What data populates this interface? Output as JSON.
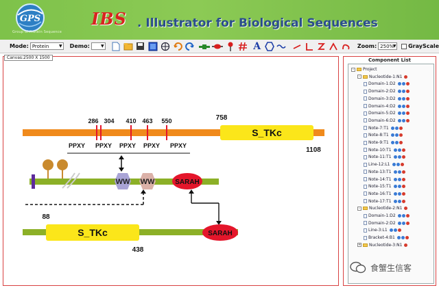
{
  "banner": {
    "logo_text": "GPS",
    "logo_subtext": "Group of Protein Sequence",
    "app_short": "IBS",
    "app_full": "Illustrator for Biological Sequences",
    "colors": {
      "banner": "#7ec24a",
      "ibs": "#d8241f",
      "tagline": "#2a4d8c"
    }
  },
  "toolbar": {
    "mode_label": "Mode:",
    "mode_value": "Protein",
    "demo_label": "Demo:",
    "demo_value": "",
    "zoom_label": "Zoom:",
    "zoom_value": "250%",
    "grayscale_label": "GrayScale",
    "grayscale_checked": false,
    "tools": [
      "new-file-icon",
      "open-file-icon",
      "save-icon",
      "canvas-icon",
      "target-icon",
      "undo-icon",
      "redo-icon",
      "domain-icon",
      "red-domain-icon",
      "pin-icon",
      "hash-icon",
      "text-icon",
      "hexagon-icon",
      "wave-icon",
      "line-icon",
      "elbow-line-icon",
      "bracket-icon",
      "arch-icon",
      "curve-icon"
    ]
  },
  "canvas": {
    "label": "Canvas:2500 X 1500",
    "protein1": {
      "start_label": "758",
      "end_label": "1108",
      "domain_label": "S_TKc",
      "sites": [
        "286",
        "304",
        "410",
        "463",
        "550"
      ],
      "motifs": [
        "PPXY",
        "PPXY",
        "PPXY",
        "PPXY",
        "PPXY"
      ]
    },
    "protein2": {
      "ww_labels": [
        "WW",
        "WW"
      ],
      "sarah_label": "SARAH"
    },
    "protein3": {
      "start_label": "88",
      "end_label": "438",
      "domain_label": "S_TKc",
      "sarah_label": "SARAH"
    },
    "colors": {
      "orange_bar": "#f08a1c",
      "green_bar": "#8cb027",
      "domain": "#fbe61a",
      "sarah": "#e4162b",
      "ww1": "#a9a4d6",
      "ww2": "#dbb1a8",
      "lollipop": "#c98a2e",
      "purple_mark": "#5d2a9b"
    }
  },
  "component_list": {
    "title": "Component List",
    "items": [
      {
        "label": "Project",
        "level": 0,
        "type": "folder",
        "toggle": "-"
      },
      {
        "label": "Nucleotide-1:N1",
        "level": 1,
        "type": "folder",
        "toggle": "-",
        "buttons": [
          "delete"
        ]
      },
      {
        "label": "Domain-1:D2",
        "level": 2,
        "type": "doc"
      },
      {
        "label": "Domain-2:D2",
        "level": 2,
        "type": "doc"
      },
      {
        "label": "Domain-3:D2",
        "level": 2,
        "type": "doc"
      },
      {
        "label": "Domain-4:D2",
        "level": 2,
        "type": "doc"
      },
      {
        "label": "Domain-5:D2",
        "level": 2,
        "type": "doc"
      },
      {
        "label": "Domain-6:D2",
        "level": 2,
        "type": "doc"
      },
      {
        "label": "Note-7:T1",
        "level": 2,
        "type": "doc"
      },
      {
        "label": "Note-8:T1",
        "level": 2,
        "type": "doc"
      },
      {
        "label": "Note-9:T1",
        "level": 2,
        "type": "doc"
      },
      {
        "label": "Note-10:T1",
        "level": 2,
        "type": "doc"
      },
      {
        "label": "Note-11:T1",
        "level": 2,
        "type": "doc"
      },
      {
        "label": "Line-12:L1",
        "level": 2,
        "type": "doc"
      },
      {
        "label": "Note-13:T1",
        "level": 2,
        "type": "doc"
      },
      {
        "label": "Note-14:T1",
        "level": 2,
        "type": "doc"
      },
      {
        "label": "Note-15:T1",
        "level": 2,
        "type": "doc"
      },
      {
        "label": "Note-16:T1",
        "level": 2,
        "type": "doc"
      },
      {
        "label": "Note-17:T1",
        "level": 2,
        "type": "doc"
      },
      {
        "label": "Nucleotide-2:N1",
        "level": 1,
        "type": "folder",
        "toggle": "-",
        "buttons": [
          "delete"
        ]
      },
      {
        "label": "Domain-1:D2",
        "level": 2,
        "type": "doc"
      },
      {
        "label": "Domain-2:D2",
        "level": 2,
        "type": "doc"
      },
      {
        "label": "Line-3:L1",
        "level": 2,
        "type": "doc"
      },
      {
        "label": "Bracket-4:B1",
        "level": 2,
        "type": "doc"
      },
      {
        "label": "Nucleotide-3:N1",
        "level": 1,
        "type": "folder",
        "toggle": "+",
        "buttons": [
          "delete"
        ]
      }
    ]
  },
  "watermark": {
    "text": "食蟹生信客"
  }
}
